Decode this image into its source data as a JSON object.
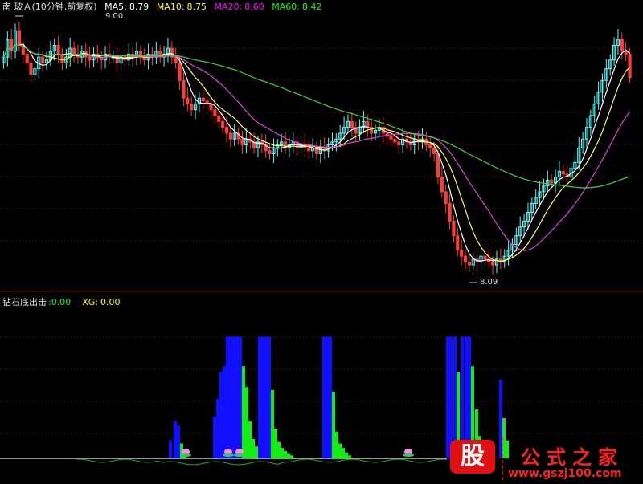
{
  "price_panel": {
    "title": "南 玻Ａ(10分钟,前复权)",
    "ma": [
      {
        "label": "MA5:",
        "value": "8.79",
        "color": "#ffffff"
      },
      {
        "label": "MA10:",
        "value": "8.75",
        "color": "#ffff00"
      },
      {
        "label": "MA20:",
        "value": "8.60",
        "color": "#ff00ff"
      },
      {
        "label": "MA60:",
        "value": "8.42",
        "color": "#00ff00"
      }
    ],
    "high_label": "9.00",
    "low_label": "8.09"
  },
  "indicator_panel": {
    "title": "钻石底出击",
    "value1": ":0.00",
    "xg_label": "XG:",
    "xg_value": "0.00"
  },
  "watermark": {
    "badge": "股",
    "text": "公式之家",
    "url": "www.gszj100.com"
  },
  "colors": {
    "up": "#54ffff",
    "down": "#ff3c3c",
    "ma5": "#ffffff",
    "ma10": "#ffff55",
    "ma20": "#e040e0",
    "ma60": "#40d040",
    "bar_blue": "#1010ff",
    "bar_green": "#11ee11",
    "grid": "#800000"
  },
  "chart_data": {
    "type": "candlestick",
    "ylim": [
      8.09,
      9.0
    ],
    "closes": [
      8.86,
      8.92,
      8.88,
      8.95,
      8.9,
      8.87,
      8.84,
      8.8,
      8.82,
      8.86,
      8.84,
      8.85,
      8.88,
      8.9,
      8.87,
      8.84,
      8.86,
      8.89,
      8.87,
      8.86,
      8.88,
      8.86,
      8.85,
      8.87,
      8.86,
      8.85,
      8.87,
      8.86,
      8.86,
      8.84,
      8.86,
      8.85,
      8.87,
      8.86,
      8.88,
      8.86,
      8.85,
      8.87,
      8.86,
      8.88,
      8.86,
      8.87,
      8.89,
      8.86,
      8.84,
      8.78,
      8.72,
      8.7,
      8.68,
      8.7,
      8.72,
      8.71,
      8.7,
      8.68,
      8.66,
      8.64,
      8.62,
      8.6,
      8.58,
      8.6,
      8.58,
      8.56,
      8.58,
      8.57,
      8.55,
      8.57,
      8.56,
      8.54,
      8.53,
      8.55,
      8.56,
      8.57,
      8.55,
      8.56,
      8.57,
      8.55,
      8.56,
      8.55,
      8.54,
      8.55,
      8.53,
      8.55,
      8.54,
      8.56,
      8.57,
      8.58,
      8.6,
      8.62,
      8.64,
      8.62,
      8.6,
      8.62,
      8.64,
      8.62,
      8.6,
      8.61,
      8.62,
      8.6,
      8.59,
      8.58,
      8.57,
      8.56,
      8.58,
      8.57,
      8.56,
      8.58,
      8.57,
      8.58,
      8.56,
      8.55,
      8.53,
      8.45,
      8.4,
      8.36,
      8.3,
      8.25,
      8.2,
      8.18,
      8.16,
      8.15,
      8.17,
      8.16,
      8.18,
      8.17,
      8.16,
      8.15,
      8.17,
      8.16,
      8.18,
      8.2,
      8.22,
      8.25,
      8.28,
      8.3,
      8.33,
      8.36,
      8.38,
      8.4,
      8.42,
      8.44,
      8.43,
      8.45,
      8.47,
      8.46,
      8.45,
      8.48,
      8.5,
      8.55,
      8.58,
      8.62,
      8.66,
      8.7,
      8.74,
      8.78,
      8.82,
      8.85,
      8.9,
      8.92,
      8.88,
      8.87,
      8.79
    ],
    "indicator": {
      "type": "bar",
      "blue": [
        [
          212,
          0.12
        ],
        [
          218,
          0.25
        ],
        [
          222,
          0.22
        ],
        [
          267,
          0.28
        ],
        [
          271,
          0.4
        ],
        [
          275,
          0.58
        ],
        [
          279,
          0.62
        ],
        [
          283,
          0.82
        ],
        [
          287,
          0.82
        ],
        [
          291,
          0.82
        ],
        [
          295,
          0.82
        ],
        [
          299,
          0.82
        ],
        [
          323,
          0.82
        ],
        [
          327,
          0.82
        ],
        [
          331,
          0.82
        ],
        [
          335,
          0.82
        ],
        [
          403,
          0.82
        ],
        [
          407,
          0.82
        ],
        [
          411,
          0.82
        ],
        [
          557,
          0.82
        ],
        [
          561,
          0.82
        ],
        [
          566,
          0.82
        ],
        [
          575,
          0.82
        ],
        [
          580,
          0.82
        ],
        [
          584,
          0.82
        ],
        [
          623,
          0.53
        ]
      ],
      "green": [
        [
          226,
          0.1
        ],
        [
          230,
          0.05
        ],
        [
          303,
          0.62
        ],
        [
          307,
          0.48
        ],
        [
          311,
          0.25
        ],
        [
          315,
          0.13
        ],
        [
          319,
          0.08
        ],
        [
          339,
          0.46
        ],
        [
          343,
          0.2
        ],
        [
          347,
          0.11
        ],
        [
          351,
          0.07
        ],
        [
          355,
          0.05
        ],
        [
          359,
          0.03
        ],
        [
          363,
          0.02
        ],
        [
          415,
          0.45
        ],
        [
          419,
          0.18
        ],
        [
          423,
          0.1
        ],
        [
          427,
          0.07
        ],
        [
          431,
          0.04
        ],
        [
          435,
          0.02
        ],
        [
          570,
          0.58
        ],
        [
          588,
          0.62
        ],
        [
          593,
          0.33
        ],
        [
          597,
          0.15
        ],
        [
          601,
          0.08
        ],
        [
          627,
          0.27
        ],
        [
          631,
          0.12
        ]
      ],
      "markers": [
        231,
        284,
        298,
        508
      ]
    }
  }
}
